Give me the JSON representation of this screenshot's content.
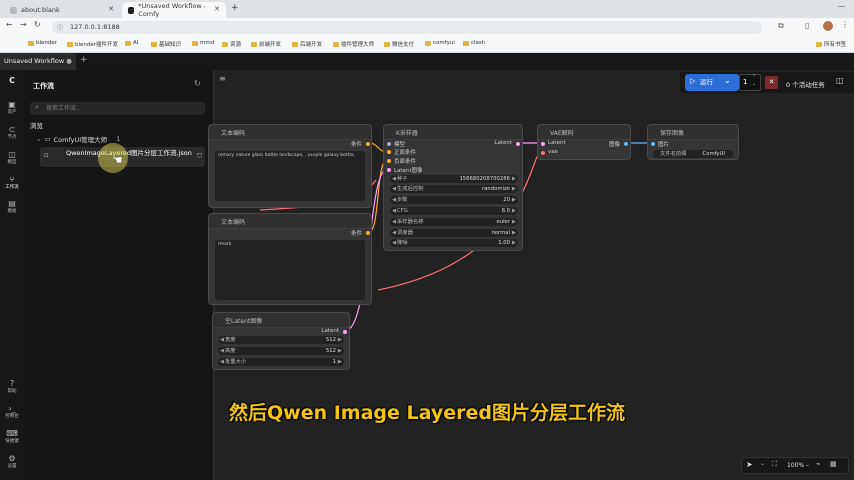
{
  "browser": {
    "tabs": [
      {
        "label": "about:blank"
      },
      {
        "label": "*Unsaved Workflow - Comfy"
      }
    ],
    "new_tab": "+",
    "url": "127.0.0.1:8188",
    "bookmarks": [
      "blender",
      "blender插件开发",
      "AI",
      "基础知识",
      "mmd",
      "资源",
      "前端开发",
      "后端开发",
      "插件管理大师",
      "微信支付",
      "comfyui",
      "clash"
    ],
    "all_bookmarks": "所有书签"
  },
  "comfy": {
    "workflow_tab": "Unsaved Workflow",
    "run_label": "运行",
    "queue_count": "1",
    "active_tasks": "0 个活动任务",
    "zoom": "100%"
  },
  "rail": [
    {
      "icon": "logo-icon",
      "label": ""
    },
    {
      "icon": "assets-icon",
      "label": "资产"
    },
    {
      "icon": "nodes-icon",
      "label": "节点"
    },
    {
      "icon": "models-icon",
      "label": "模型"
    },
    {
      "icon": "workflow-icon",
      "label": "工作流"
    },
    {
      "icon": "templates-icon",
      "label": "模板"
    },
    {
      "icon": "help-icon",
      "label": "帮助"
    },
    {
      "icon": "console-icon",
      "label": "控制台"
    },
    {
      "icon": "shortcuts-icon",
      "label": "快捷键"
    },
    {
      "icon": "settings-icon",
      "label": "设置"
    }
  ],
  "panel": {
    "title": "工作流",
    "search_placeholder": "搜索工作流...",
    "section": "浏览",
    "folder": "ComfyUI管理大师",
    "folder_count": "1",
    "file": "QwenImageLayered图片分层工作流.json"
  },
  "nodes": {
    "clip1": {
      "title": "文本编码",
      "output": "条件",
      "text": "romary nature glass bottle landscape, , purple galaxy bottle,"
    },
    "clip2": {
      "title": "文本编码",
      "output": "条件",
      "text": "rmark"
    },
    "ksampler": {
      "title": "K采样器",
      "inputs": [
        "模型",
        "正面条件",
        "负面条件",
        "Latent图像"
      ],
      "output": "Latent",
      "widgets": [
        {
          "label": "种子",
          "value": "156680208700286"
        },
        {
          "label": "生成后控制",
          "value": "randomize"
        },
        {
          "label": "步数",
          "value": "20"
        },
        {
          "label": "CFG",
          "value": "8.0"
        },
        {
          "label": "采样器名称",
          "value": "euler"
        },
        {
          "label": "调度器",
          "value": "normal"
        },
        {
          "label": "降噪",
          "value": "1.00"
        }
      ]
    },
    "vae": {
      "title": "VAE解码",
      "inputs": [
        "Latent",
        "vae"
      ],
      "output": "图像"
    },
    "save": {
      "title": "保存图像",
      "input": "图片",
      "widget_label": "文件名前缀",
      "widget_value": "ComfyUI"
    },
    "latent": {
      "title": "空Latent图像",
      "output": "Latent",
      "widgets": [
        {
          "label": "宽度",
          "value": "512"
        },
        {
          "label": "高度",
          "value": "512"
        },
        {
          "label": "批量大小",
          "value": "1"
        }
      ]
    }
  },
  "subtitle": "然后Qwen Image Layered图片分层工作流",
  "colors": {
    "accent": "#2b6fd6",
    "subtitle": "#f2c318",
    "link_latent": "#ff9cf9",
    "link_image": "#64b5f6",
    "link_cond": "#ffa931"
  }
}
